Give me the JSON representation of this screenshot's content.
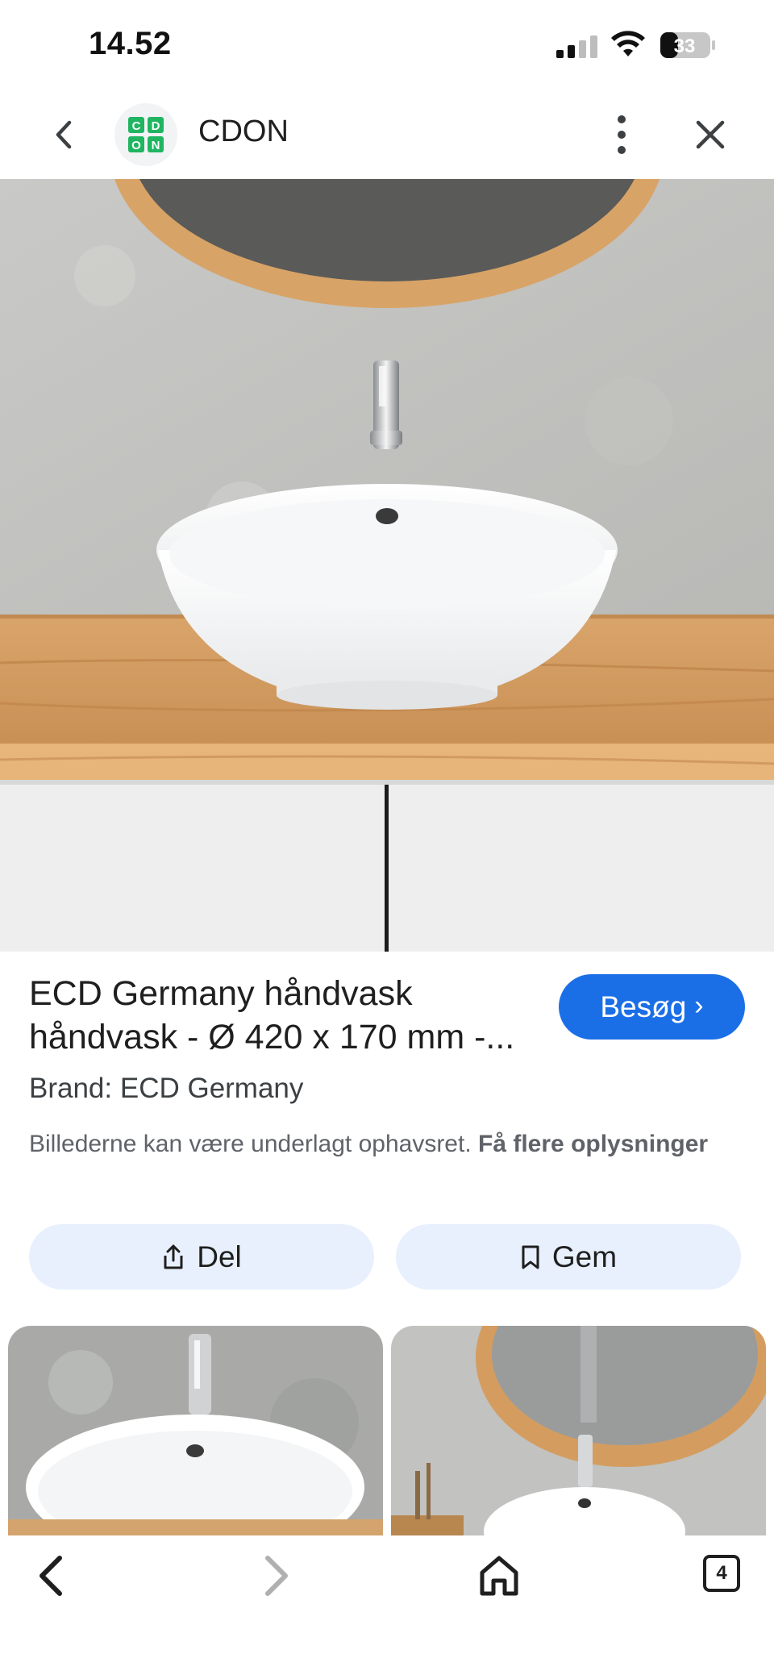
{
  "status_bar": {
    "time": "14.52",
    "battery_level": "33",
    "icons": [
      "signal-icon",
      "wifi-icon",
      "battery-icon"
    ]
  },
  "header": {
    "site_name": "CDON",
    "logo_letters": [
      "C",
      "D",
      "O",
      "N"
    ],
    "back_icon": "chevron-left-icon",
    "more_icon": "more-vert-icon",
    "close_icon": "close-icon"
  },
  "product": {
    "title": "ECD Germany håndvask håndvask - Ø 420 x 170 mm -...",
    "brand": "Brand: ECD Germany",
    "visit_label": "Besøg",
    "notice_text": "Billederne kan være underlagt ophavsret.",
    "notice_link": "Få flere oplysninger"
  },
  "actions": {
    "share_label": "Del",
    "save_label": "Gem"
  },
  "bottom_nav": {
    "tab_count": "4"
  },
  "colors": {
    "accent": "#1b6fe6",
    "action_bg": "#e8f0fe",
    "logo_green": "#1fb561"
  }
}
